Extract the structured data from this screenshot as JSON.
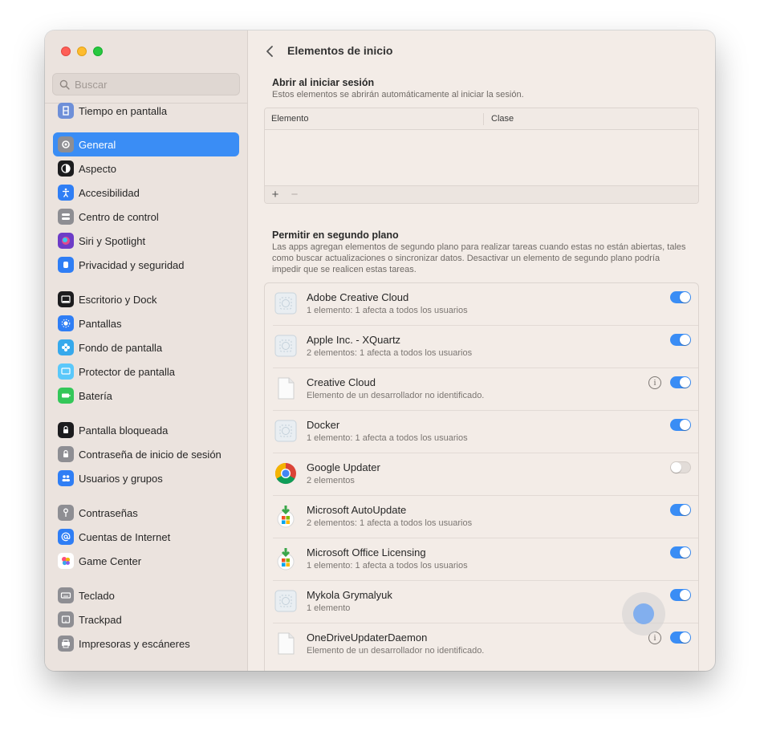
{
  "colors": {
    "accent": "#3a8df5",
    "sidebar_bg": "#ebe3de",
    "content_bg": "#f3ece7"
  },
  "search": {
    "placeholder": "Buscar"
  },
  "sidebar": {
    "items": [
      {
        "label": "Tiempo en pantalla",
        "icon": "hourglass-icon"
      },
      {
        "label": "General",
        "icon": "gear-icon",
        "active": true
      },
      {
        "label": "Aspecto",
        "icon": "appearance-icon"
      },
      {
        "label": "Accesibilidad",
        "icon": "accessibility-icon"
      },
      {
        "label": "Centro de control",
        "icon": "control-center-icon"
      },
      {
        "label": "Siri y Spotlight",
        "icon": "siri-icon"
      },
      {
        "label": "Privacidad y seguridad",
        "icon": "hand-icon"
      },
      {
        "label": "Escritorio y Dock",
        "icon": "dock-icon"
      },
      {
        "label": "Pantallas",
        "icon": "sun-icon"
      },
      {
        "label": "Fondo de pantalla",
        "icon": "flower-icon"
      },
      {
        "label": "Protector de pantalla",
        "icon": "screensaver-icon"
      },
      {
        "label": "Batería",
        "icon": "battery-icon"
      },
      {
        "label": "Pantalla bloqueada",
        "icon": "lock-screen-icon"
      },
      {
        "label": "Contraseña de inicio de sesión",
        "icon": "lock-icon"
      },
      {
        "label": "Usuarios y grupos",
        "icon": "users-icon"
      },
      {
        "label": "Contraseñas",
        "icon": "key-icon"
      },
      {
        "label": "Cuentas de Internet",
        "icon": "at-icon"
      },
      {
        "label": "Game Center",
        "icon": "game-center-icon"
      },
      {
        "label": "Teclado",
        "icon": "keyboard-icon"
      },
      {
        "label": "Trackpad",
        "icon": "trackpad-icon"
      },
      {
        "label": "Impresoras y escáneres",
        "icon": "printer-icon"
      }
    ]
  },
  "header": {
    "title": "Elementos de inicio"
  },
  "login_items": {
    "title": "Abrir al iniciar sesión",
    "subtitle": "Estos elementos se abrirán automáticamente al iniciar la sesión.",
    "col_item": "Elemento",
    "col_kind": "Clase",
    "add": "+",
    "remove": "−"
  },
  "background": {
    "title": "Permitir en segundo plano",
    "subtitle": "Las apps agregan elementos de segundo plano para realizar tareas cuando estas no están abiertas, tales como buscar actualizaciones o sincronizar datos. Desactivar un elemento de segundo plano podría impedir que se realicen estas tareas.",
    "items": [
      {
        "name": "Adobe Creative Cloud",
        "desc": "1 elemento: 1 afecta a todos los usuarios",
        "icon": "generic-app-icon",
        "enabled": true,
        "info": false
      },
      {
        "name": "Apple Inc. - XQuartz",
        "desc": "2 elementos: 1 afecta a todos los usuarios",
        "icon": "generic-app-icon",
        "enabled": true,
        "info": false
      },
      {
        "name": "Creative Cloud",
        "desc": "Elemento de un desarrollador no identificado.",
        "icon": "document-icon",
        "enabled": true,
        "info": true
      },
      {
        "name": "Docker",
        "desc": "1 elemento: 1 afecta a todos los usuarios",
        "icon": "generic-app-icon",
        "enabled": true,
        "info": false
      },
      {
        "name": "Google Updater",
        "desc": "2 elementos",
        "icon": "chrome-icon",
        "enabled": false,
        "info": false
      },
      {
        "name": "Microsoft AutoUpdate",
        "desc": "2 elementos: 1 afecta a todos los usuarios",
        "icon": "microsoft-update-icon",
        "enabled": true,
        "info": false
      },
      {
        "name": "Microsoft Office Licensing",
        "desc": "1 elemento: 1 afecta a todos los usuarios",
        "icon": "microsoft-update-icon",
        "enabled": true,
        "info": false
      },
      {
        "name": "Mykola Grymalyuk",
        "desc": "1 elemento",
        "icon": "generic-app-icon",
        "enabled": true,
        "info": false
      },
      {
        "name": "OneDriveUpdaterDaemon",
        "desc": "Elemento de un desarrollador no identificado.",
        "icon": "document-icon",
        "enabled": true,
        "info": true
      }
    ]
  }
}
